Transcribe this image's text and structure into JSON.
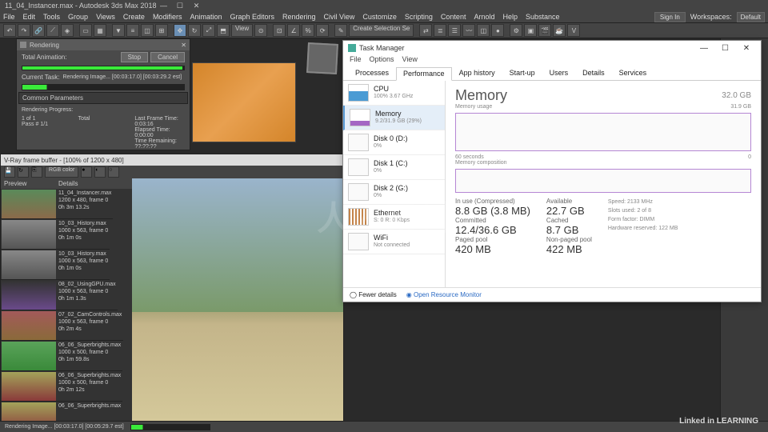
{
  "app": {
    "title": "11_04_Instancer.max - Autodesk 3ds Max 2018",
    "menu": [
      "File",
      "Edit",
      "Tools",
      "Group",
      "Views",
      "Create",
      "Modifiers",
      "Animation",
      "Graph Editors",
      "Rendering",
      "Civil View",
      "Customize",
      "Scripting",
      "Content",
      "Arnold",
      "Help",
      "Substance"
    ],
    "signin": "Sign In",
    "workspaces_label": "Workspaces:",
    "workspaces_value": "Default",
    "toolbar_view": "View",
    "toolbar_selset": "Create Selection Se"
  },
  "render": {
    "title": "Rendering",
    "total_anim": "Total Animation:",
    "stop": "Stop",
    "cancel": "Cancel",
    "current_task": "Current Task:",
    "current_task_value": "Rendering Image...  [00:03:17.0]  [00:03:29.2 est]",
    "section": "Common Parameters",
    "progress_label": "Rendering Progress:",
    "frame": "1 of 1",
    "total_label": "Total",
    "pass": "Pass # 1/1",
    "lastframe": "Last Frame Time: 0:03:16",
    "elapsed": "Elapsed Time: 0:00:00",
    "remaining": "Time Remaining: ??:??:??"
  },
  "vray": {
    "title": "V-Ray frame buffer - [100% of 1200 x 480]",
    "channel": "RGB color",
    "preview": "Preview",
    "details": "Details",
    "history": [
      {
        "name": "11_04_Instancer.max",
        "meta": "1200 x 480, frame 0",
        "time": "0h 3m 13.2s"
      },
      {
        "name": "10_03_History.max",
        "meta": "1000 x 563, frame 0",
        "time": "0h 1m 0s"
      },
      {
        "name": "10_03_History.max",
        "meta": "1000 x 563, frame 0",
        "time": "0h 1m 0s"
      },
      {
        "name": "08_02_UsingGPU.max",
        "meta": "1000 x 563, frame 0",
        "time": "0h 1m 1.3s"
      },
      {
        "name": "07_02_CamControls.max",
        "meta": "1000 x 563, frame 0",
        "time": "0h 2m 4s"
      },
      {
        "name": "06_06_Superbrights.max",
        "meta": "1000 x 500, frame 0",
        "time": "0h 1m 59.8s"
      },
      {
        "name": "06_06_Superbrights.max",
        "meta": "1000 x 500, frame 0",
        "time": "0h 2m 12s"
      },
      {
        "name": "06_06_Superbrights.max",
        "meta": "",
        "time": ""
      }
    ]
  },
  "taskman": {
    "title": "Task Manager",
    "menu": [
      "File",
      "Options",
      "View"
    ],
    "tabs": [
      "Processes",
      "Performance",
      "App history",
      "Start-up",
      "Users",
      "Details",
      "Services"
    ],
    "active_tab": "Performance",
    "side": [
      {
        "label": "CPU",
        "sub": "100%  3.67 GHz"
      },
      {
        "label": "Memory",
        "sub": "9.2/31.9 GB (29%)"
      },
      {
        "label": "Disk 0 (D:)",
        "sub": "0%"
      },
      {
        "label": "Disk 1 (C:)",
        "sub": "0%"
      },
      {
        "label": "Disk 2 (G:)",
        "sub": "0%"
      },
      {
        "label": "Ethernet",
        "sub": "S: 0 R: 0 Kbps"
      },
      {
        "label": "WiFi",
        "sub": "Not connected"
      }
    ],
    "heading": "Memory",
    "capacity": "32.0 GB",
    "graph1_label": "Memory usage",
    "graph1_max": "31.9 GB",
    "graph1_xleft": "60 seconds",
    "graph1_xright": "0",
    "graph2_label": "Memory composition",
    "stats": {
      "inuse_label": "In use (Compressed)",
      "inuse": "8.8 GB (3.8 MB)",
      "avail_label": "Available",
      "avail": "22.7 GB",
      "commit_label": "Committed",
      "commit": "12.4/36.6 GB",
      "cached_label": "Cached",
      "cached": "8.7 GB",
      "paged_label": "Paged pool",
      "paged": "420 MB",
      "nonpaged_label": "Non-paged pool",
      "nonpaged": "422 MB"
    },
    "hw": {
      "speed_label": "Speed:",
      "speed": "2133 MHz",
      "slots_label": "Slots used:",
      "slots": "2 of 8",
      "form_label": "Form factor:",
      "form": "DIMM",
      "reserved_label": "Hardware reserved:",
      "reserved": "122 MB"
    },
    "fewer": "Fewer details",
    "resmon": "Open Resource Monitor"
  },
  "status": {
    "rendering": "Rendering Image...   [00:03:17.0]  [00:05:29.7 est]"
  },
  "watermark": "Linked in LEARNING",
  "watermark2": "人人素材"
}
